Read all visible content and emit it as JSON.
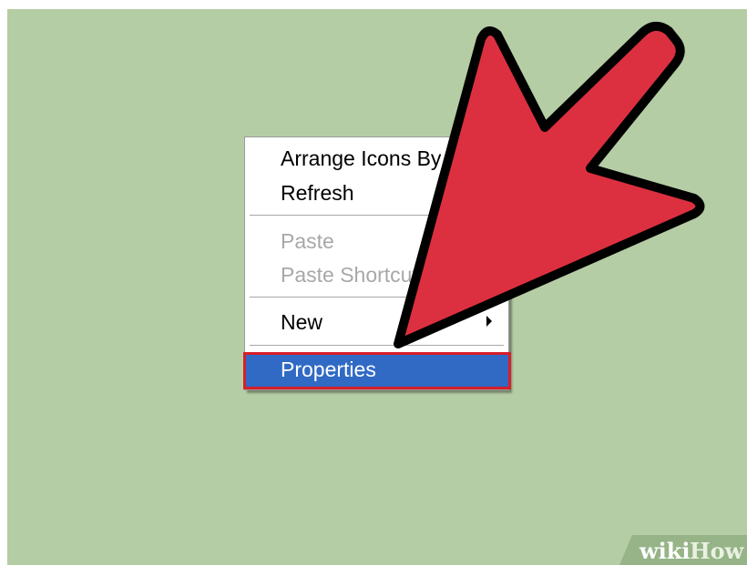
{
  "context_menu": {
    "items": [
      {
        "label": "Arrange Icons By",
        "state": "enabled"
      },
      {
        "label": "Refresh",
        "state": "enabled"
      },
      {
        "label": "Paste",
        "state": "disabled"
      },
      {
        "label": "Paste Shortcut",
        "state": "disabled"
      },
      {
        "label": "New",
        "state": "enabled",
        "has_submenu": true
      },
      {
        "label": "Properties",
        "state": "selected"
      }
    ],
    "submenu_icon": "chevron-right-icon",
    "selected_color": "#316ac5",
    "highlight_outline_color": "#d81e2a"
  },
  "desktop": {
    "background_color": "#b5cda4"
  },
  "annotation": {
    "icon": "pointer-arrow-icon",
    "color": "#dc3040"
  },
  "watermark": {
    "wiki": "wiki",
    "how": "How"
  }
}
